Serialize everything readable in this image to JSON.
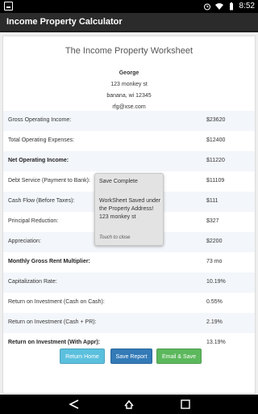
{
  "status_bar": {
    "time": "8:52",
    "icons": [
      "notification-icon",
      "alarm-icon",
      "wifi-icon",
      "battery-icon"
    ]
  },
  "app": {
    "title": "Income Property Calculator"
  },
  "worksheet": {
    "heading": "The Income Property Worksheet",
    "owner": {
      "name": "George",
      "street": "123 monkey st",
      "city": "banana, wi 12345",
      "email": "rfg@xse.com"
    },
    "rows": [
      {
        "label": "Gross Operating Income:",
        "value": "$23620",
        "bold": false
      },
      {
        "label": "Total Operating Expenses:",
        "value": "$12400",
        "bold": false
      },
      {
        "label": "Net Operating Income:",
        "value": "$11220",
        "bold": true
      },
      {
        "label": "Debt Service (Payment to Bank):",
        "value": "$11109",
        "bold": false
      },
      {
        "label": "Cash Flow (Before Taxes):",
        "value": "$111",
        "bold": false
      },
      {
        "label": "Principal Reduction:",
        "value": "$327",
        "bold": false
      },
      {
        "label": "Appreciation:",
        "value": "$2200",
        "bold": false
      },
      {
        "label": "Monthly Gross Rent Multiplier:",
        "value": "73 mo",
        "bold": true
      },
      {
        "label": "Capitalization Rate:",
        "value": "10.19%",
        "bold": false
      },
      {
        "label": "Return on Investment (Cash on Cash):",
        "value": "0.55%",
        "bold": false
      },
      {
        "label": "Return on Investment (Cash + PR):",
        "value": "2.19%",
        "bold": false
      },
      {
        "label": "Return on Investment (With Appr):",
        "value": "13.19%",
        "bold": true
      }
    ]
  },
  "buttons": {
    "return_home": "Return Home",
    "save_report": "Save Report",
    "email_save": "Email & Save"
  },
  "toast": {
    "title": "Save Complete",
    "message": "WorkSheet Saved under the Property Address! 123 monkey st",
    "close_hint": "Touch to close"
  },
  "colors": {
    "action_bar": "#2b2b2b",
    "return_home": "#5bc0de",
    "save_report": "#337ab7",
    "email_save": "#5cb85c",
    "row_stripe": "#f3f6fa"
  }
}
